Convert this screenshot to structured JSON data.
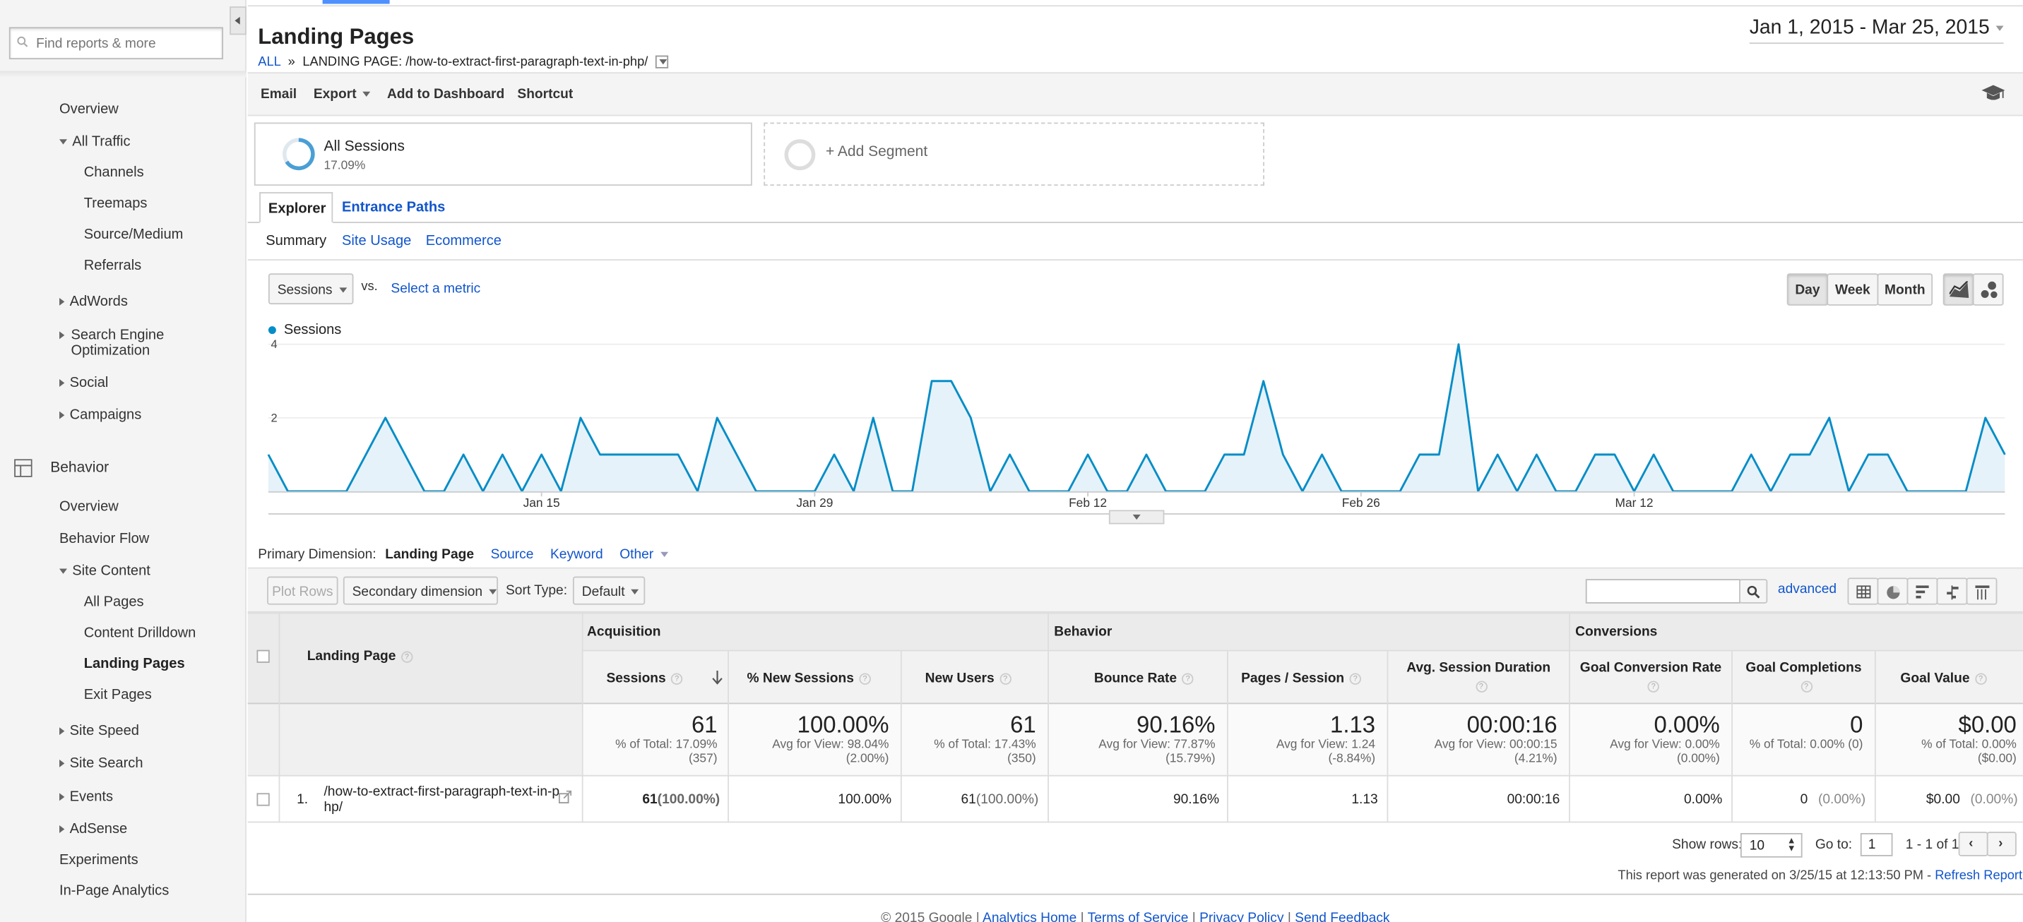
{
  "sidebar": {
    "search_placeholder": "Find reports & more",
    "items": [
      {
        "label": "Overview"
      },
      {
        "label": "All Traffic"
      },
      {
        "label": "Channels"
      },
      {
        "label": "Treemaps"
      },
      {
        "label": "Source/Medium"
      },
      {
        "label": "Referrals"
      },
      {
        "label": "AdWords"
      },
      {
        "label": "Search Engine Optimization"
      },
      {
        "label": "Social"
      },
      {
        "label": "Campaigns"
      },
      {
        "label": "Behavior"
      },
      {
        "label": "Overview"
      },
      {
        "label": "Behavior Flow"
      },
      {
        "label": "Site Content"
      },
      {
        "label": "All Pages"
      },
      {
        "label": "Content Drilldown"
      },
      {
        "label": "Landing Pages"
      },
      {
        "label": "Exit Pages"
      },
      {
        "label": "Site Speed"
      },
      {
        "label": "Site Search"
      },
      {
        "label": "Events"
      },
      {
        "label": "AdSense"
      },
      {
        "label": "Experiments"
      },
      {
        "label": "In-Page Analytics"
      }
    ]
  },
  "header": {
    "title": "Landing Pages",
    "crumb_all": "ALL",
    "crumb_sep": "»",
    "crumb_page": "LANDING PAGE: /how-to-extract-first-paragraph-text-in-php/",
    "date_range": "Jan 1, 2015 - Mar 25, 2015"
  },
  "toolbar": {
    "email": "Email",
    "export": "Export",
    "add_dashboard": "Add to Dashboard",
    "shortcut": "Shortcut"
  },
  "segments": {
    "all_label": "All Sessions",
    "all_pct": "17.09%",
    "add_label": "+ Add Segment"
  },
  "tabs": {
    "explorer": "Explorer",
    "entrance_paths": "Entrance Paths"
  },
  "subtabs": {
    "summary": "Summary",
    "site_usage": "Site Usage",
    "ecommerce": "Ecommerce"
  },
  "graph_controls": {
    "metric": "Sessions",
    "vs": "vs.",
    "select_metric": "Select a metric",
    "day": "Day",
    "week": "Week",
    "month": "Month"
  },
  "chart_data": {
    "type": "area",
    "series": [
      {
        "name": "Sessions",
        "values": [
          1,
          0,
          0,
          0,
          0,
          1,
          2,
          1,
          0,
          0,
          1,
          0,
          1,
          0,
          1,
          0,
          2,
          1,
          1,
          1,
          1,
          1,
          0,
          2,
          1,
          0,
          0,
          0,
          0,
          1,
          0,
          2,
          0,
          0,
          3,
          3,
          2,
          0,
          1,
          0,
          0,
          0,
          1,
          0,
          0,
          1,
          0,
          0,
          0,
          1,
          1,
          3,
          1,
          0,
          1,
          0,
          0,
          0,
          0,
          1,
          1,
          4,
          0,
          1,
          0,
          1,
          0,
          0,
          1,
          1,
          0,
          1,
          0,
          0,
          0,
          0,
          1,
          0,
          1,
          1,
          2,
          0,
          1,
          1,
          0,
          0,
          0,
          0,
          2,
          1
        ]
      }
    ],
    "x_tick_labels": [
      "Jan 15",
      "Jan 29",
      "Feb 12",
      "Feb 26",
      "Mar 12"
    ],
    "y_tick_labels": [
      "2",
      "4"
    ],
    "ylim": [
      0,
      4
    ],
    "color": "#058dc7",
    "fill": "#e6f2f9",
    "grid": true,
    "legend": "top-left"
  },
  "dimensions": {
    "label": "Primary Dimension:",
    "current": "Landing Page",
    "source": "Source",
    "keyword": "Keyword",
    "other": "Other"
  },
  "table_tools": {
    "plot_rows": "Plot Rows",
    "secondary": "Secondary dimension",
    "sort_label": "Sort Type:",
    "sort_value": "Default",
    "advanced": "advanced"
  },
  "table": {
    "groups": {
      "acquisition": "Acquisition",
      "behavior": "Behavior",
      "conversions": "Conversions"
    },
    "dim_header": "Landing Page",
    "columns": [
      "Sessions",
      "% New Sessions",
      "New Users",
      "Bounce Rate",
      "Pages / Session",
      "Avg. Session Duration",
      "Goal Conversion Rate",
      "Goal Completions",
      "Goal Value"
    ],
    "totals": [
      {
        "value": "61",
        "sub1": "% of Total: 17.09%",
        "sub2": "(357)"
      },
      {
        "value": "100.00%",
        "sub1": "Avg for View: 98.04%",
        "sub2": "(2.00%)"
      },
      {
        "value": "61",
        "sub1": "% of Total: 17.43%",
        "sub2": "(350)"
      },
      {
        "value": "90.16%",
        "sub1": "Avg for View: 77.87%",
        "sub2": "(15.79%)"
      },
      {
        "value": "1.13",
        "sub1": "Avg for View: 1.24",
        "sub2": "(-8.84%)"
      },
      {
        "value": "00:00:16",
        "sub1": "Avg for View: 00:00:15",
        "sub2": "(4.21%)"
      },
      {
        "value": "0.00%",
        "sub1": "Avg for View: 0.00%",
        "sub2": "(0.00%)"
      },
      {
        "value": "0",
        "sub1": "% of Total: 0.00% (0)",
        "sub2": ""
      },
      {
        "value": "$0.00",
        "sub1": "% of Total: 0.00%",
        "sub2": "($0.00)"
      }
    ],
    "row": {
      "index": "1.",
      "page": "/how-to-extract-first-paragraph-text-in-php/",
      "sessions": "61",
      "sessions_pct": "(100.00%)",
      "new_sessions": "100.00%",
      "new_users": "61",
      "new_users_pct": "(100.00%)",
      "bounce": "90.16%",
      "pages": "1.13",
      "duration": "00:00:16",
      "gcr": "0.00%",
      "gc": "0",
      "gc_pct": "(0.00%)",
      "gv": "$0.00",
      "gv_pct": "(0.00%)"
    }
  },
  "pagination": {
    "show_rows": "Show rows:",
    "rows_value": "10",
    "goto": "Go to:",
    "goto_value": "1",
    "range": "1 - 1 of 1"
  },
  "report_gen": {
    "text": "This report was generated on 3/25/15 at 12:13:50 PM -",
    "refresh": "Refresh Report"
  },
  "footer": {
    "copyright": "© 2015 Google",
    "sep": "|",
    "home": "Analytics Home",
    "terms": "Terms of Service",
    "privacy": "Privacy Policy",
    "feedback": "Send Feedback"
  }
}
